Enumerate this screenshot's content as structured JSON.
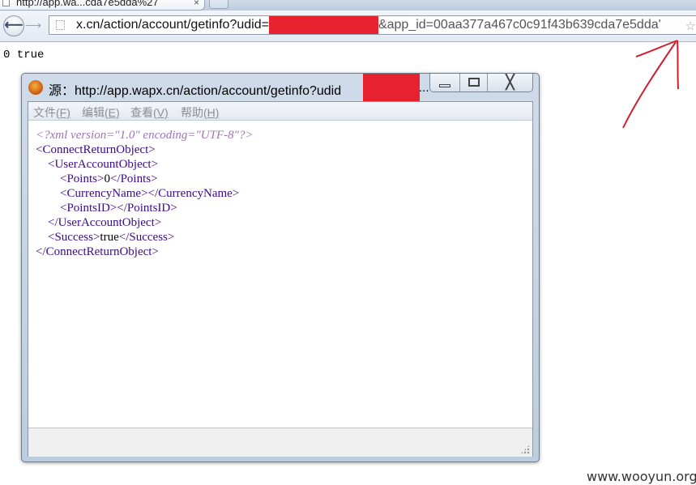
{
  "browser": {
    "tab_title": "http://app.wa...cda7e5dda%27",
    "tab_close": "×",
    "url_prefix": "x.cn/action/account/getinfo?udid=",
    "url_suffix": "&app_id=00aa377a467c0c91f43b639cda7e5dda'",
    "star_icon": "☆"
  },
  "page": {
    "output": "0 true"
  },
  "source_window": {
    "title": "源：http://app.wapx.cn/action/account/getinfo?udid",
    "title_ellipsis": "...",
    "close_glyph": "╳",
    "menu": [
      {
        "label": "文件",
        "key": "(F)"
      },
      {
        "label": "编辑",
        "key": "(E)"
      },
      {
        "label": "查看",
        "key": "(V)"
      },
      {
        "label": "帮助",
        "key": "(H)"
      }
    ],
    "source_lines": [
      {
        "text": "<?xml version=\"1.0\" encoding=\"UTF-8\"?>",
        "kind": "pi"
      },
      {
        "text": "<ConnectReturnObject>",
        "kind": "tag"
      },
      {
        "text": "    <UserAccountObject>",
        "kind": "tag"
      },
      {
        "text": "        <Points>",
        "kind": "tag",
        "value": "0",
        "close": "</Points>"
      },
      {
        "text": "        <CurrencyName>",
        "kind": "tag",
        "value": "",
        "close": "</CurrencyName>"
      },
      {
        "text": "        <PointsID>",
        "kind": "tag",
        "value": "",
        "close": "</PointsID>"
      },
      {
        "text": "    </UserAccountObject>",
        "kind": "tag"
      },
      {
        "text": "    <Success>",
        "kind": "tag",
        "value": "true",
        "close": "</Success>"
      },
      {
        "text": "</ConnectReturnObject>",
        "kind": "tag"
      }
    ]
  },
  "colors": {
    "redaction": "#e8212e",
    "xml_pi": "#a173b9",
    "xml_tag": "#3a0a8a",
    "annotation_arrow": "#d21f2a"
  },
  "watermark": "www.wooyun.org"
}
